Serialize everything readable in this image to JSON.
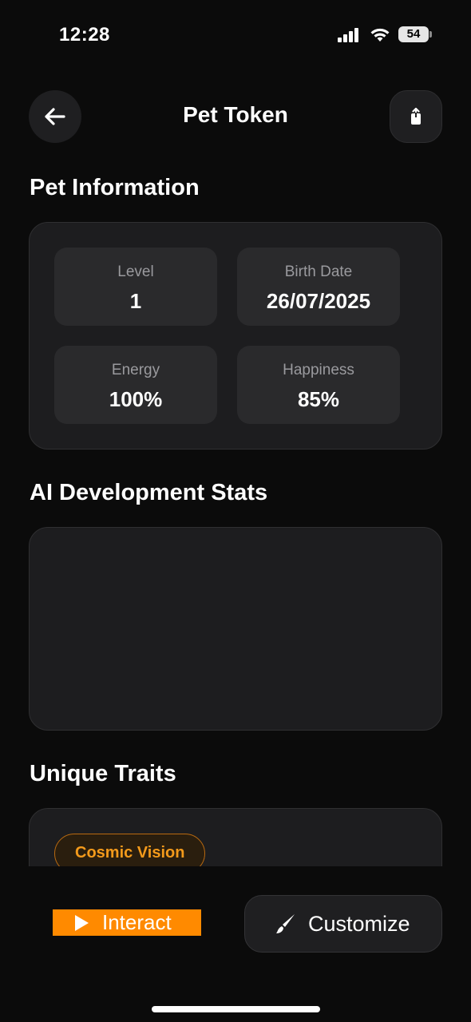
{
  "status_bar": {
    "time": "12:28",
    "battery_level": "54",
    "icons": [
      "signal-icon",
      "wifi-icon",
      "battery-icon"
    ]
  },
  "header": {
    "title": "Pet Token",
    "back_icon": "arrow-left-icon",
    "share_icon": "share-icon"
  },
  "pet_info": {
    "title": "Pet Information",
    "stats": [
      {
        "label": "Level",
        "value": "1"
      },
      {
        "label": "Birth Date",
        "value": "26/07/2025"
      },
      {
        "label": "Energy",
        "value": "100%"
      },
      {
        "label": "Happiness",
        "value": "85%"
      }
    ]
  },
  "ai_stats": {
    "title": "AI Development Stats"
  },
  "traits": {
    "title": "Unique Traits",
    "items": [
      "Cosmic Vision"
    ]
  },
  "actions": {
    "interact_label": "Interact",
    "interact_icon": "play-icon",
    "customize_label": "Customize",
    "customize_icon": "brush-icon"
  },
  "colors": {
    "background": "#0b0b0b",
    "card": "#1d1d1f",
    "tile": "#2a2a2c",
    "accent": "#ff8a00",
    "trait_text": "#f39a1b"
  }
}
